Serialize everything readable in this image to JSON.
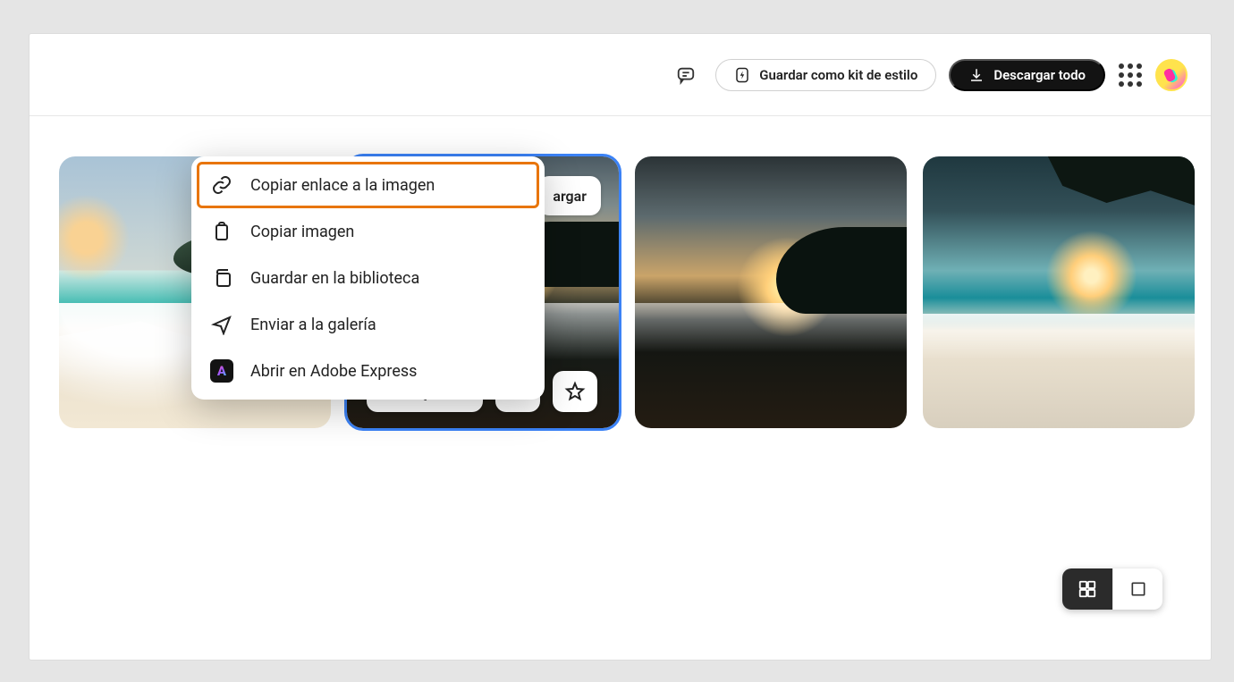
{
  "header": {
    "save_style_label": "Guardar como kit de estilo",
    "download_all_label": "Descargar todo"
  },
  "thumb_overlay": {
    "download_label_partial": "argar"
  },
  "context_menu": {
    "copy_link": "Copiar enlace a la imagen",
    "copy_image": "Copiar imagen",
    "save_library": "Guardar en la biblioteca",
    "send_gallery": "Enviar a la galería",
    "open_express": "Abrir en Adobe Express"
  },
  "express_badge": "A"
}
